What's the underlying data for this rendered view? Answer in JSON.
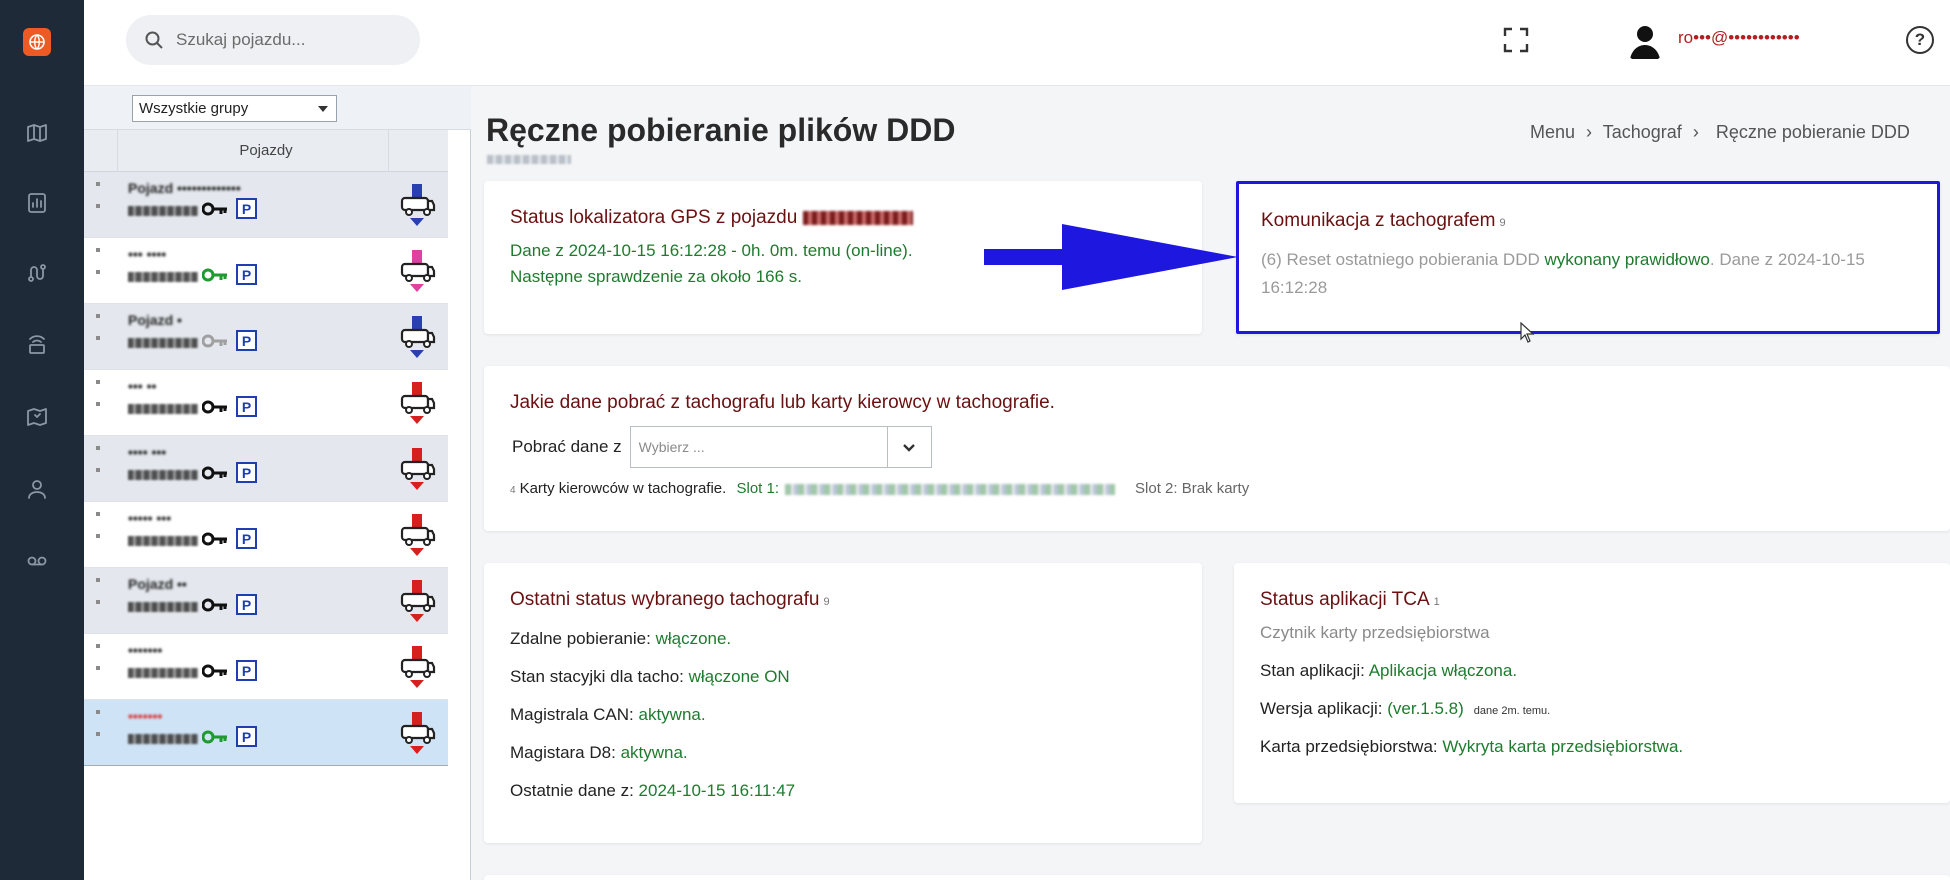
{
  "search": {
    "placeholder": "Szukaj pojazdu..."
  },
  "user": {
    "name": "ro•••@••••••••••••"
  },
  "help_label": "?",
  "vehicles_panel": {
    "group_filter": "Wszystkie grupy",
    "column_header": "Pojazdy",
    "rows": [
      {
        "name": "Pojazd •••••••••••••",
        "key_color": "#111111",
        "truck_color": "#2a3fb0",
        "style": "alt"
      },
      {
        "name": "••• ••••",
        "key_color": "#1e9a2e",
        "truck_color": "#e040a0",
        "style": ""
      },
      {
        "name": "Pojazd •",
        "key_color": "#a0a0a0",
        "truck_color": "#2a3fb0",
        "style": "alt"
      },
      {
        "name": "••• ••",
        "key_color": "#111111",
        "truck_color": "#d62020",
        "style": ""
      },
      {
        "name": "•••• •••",
        "key_color": "#111111",
        "truck_color": "#d62020",
        "style": "alt"
      },
      {
        "name": "••••• •••",
        "key_color": "#111111",
        "truck_color": "#d62020",
        "style": ""
      },
      {
        "name": "Pojazd ••",
        "key_color": "#111111",
        "truck_color": "#d62020",
        "style": "alt"
      },
      {
        "name": "•••••••",
        "key_color": "#111111",
        "truck_color": "#d62020",
        "style": ""
      },
      {
        "name": "•••••••",
        "key_color": "#1e9a2e",
        "truck_color": "#d62020",
        "style": "sel"
      }
    ],
    "parking_label": "P"
  },
  "page": {
    "title": "Ręczne pobieranie plików DDD",
    "breadcrumb": [
      "Menu",
      "Tachograf",
      "Ręczne pobieranie DDD"
    ],
    "breadcrumb_sep": "›"
  },
  "gps_card": {
    "title": "Status lokalizatora GPS z pojazdu",
    "line1": "Dane z 2024-10-15 16:12:28 - 0h. 0m. temu (on-line).",
    "line2": "Następne sprawdzenie za około 166 s."
  },
  "comm_card": {
    "title": "Komunikacja z tachografem",
    "count": "9",
    "text_before": "(6) Reset ostatniego pobierania DDD",
    "text_status": "wykonany prawidłowo",
    "text_after": ". Dane z 2024-10-15 16:12:28"
  },
  "download_card": {
    "title": "Jakie dane pobrać z tachografu lub karty kierowcy w tachografie.",
    "label": "Pobrać dane z",
    "select_placeholder": "Wybierz ...",
    "cards_count": "4",
    "cards_label": "Karty kierowców w tachografie.",
    "slot1_label": "Slot 1:",
    "slot2_label": "Slot 2: Brak karty"
  },
  "last_status_card": {
    "title": "Ostatni status wybranego tachografu",
    "count": "9",
    "rows": [
      {
        "label": "Zdalne pobieranie:",
        "value": "włączone."
      },
      {
        "label": "Stan stacyjki dla tacho:",
        "value": "włączone ON"
      },
      {
        "label": "Magistrala CAN:",
        "value": "aktywna."
      },
      {
        "label": "Magistara D8:",
        "value": "aktywna."
      },
      {
        "label": "Ostatnie dane z:",
        "value": "2024-10-15 16:11:47"
      }
    ]
  },
  "tca_card": {
    "title": "Status aplikacji TCA",
    "count": "1",
    "subtitle": "Czytnik karty przedsiębiorstwa",
    "app_state_label": "Stan aplikacji:",
    "app_state_value": "Aplikacja włączona.",
    "version_label": "Wersja aplikacji:",
    "version_value": "(ver.1.5.8)",
    "version_note": "dane 2m. temu.",
    "company_card_label": "Karta przedsiębiorstwa:",
    "company_card_value": "Wykryta karta przedsiębiorstwa."
  },
  "colors": {
    "accent_arrow": "#1d17e0",
    "highlight_border": "#1d17e0",
    "status_green": "#1e7b2e",
    "title_red": "#6b1010",
    "sidebar": "#1e2a38"
  }
}
